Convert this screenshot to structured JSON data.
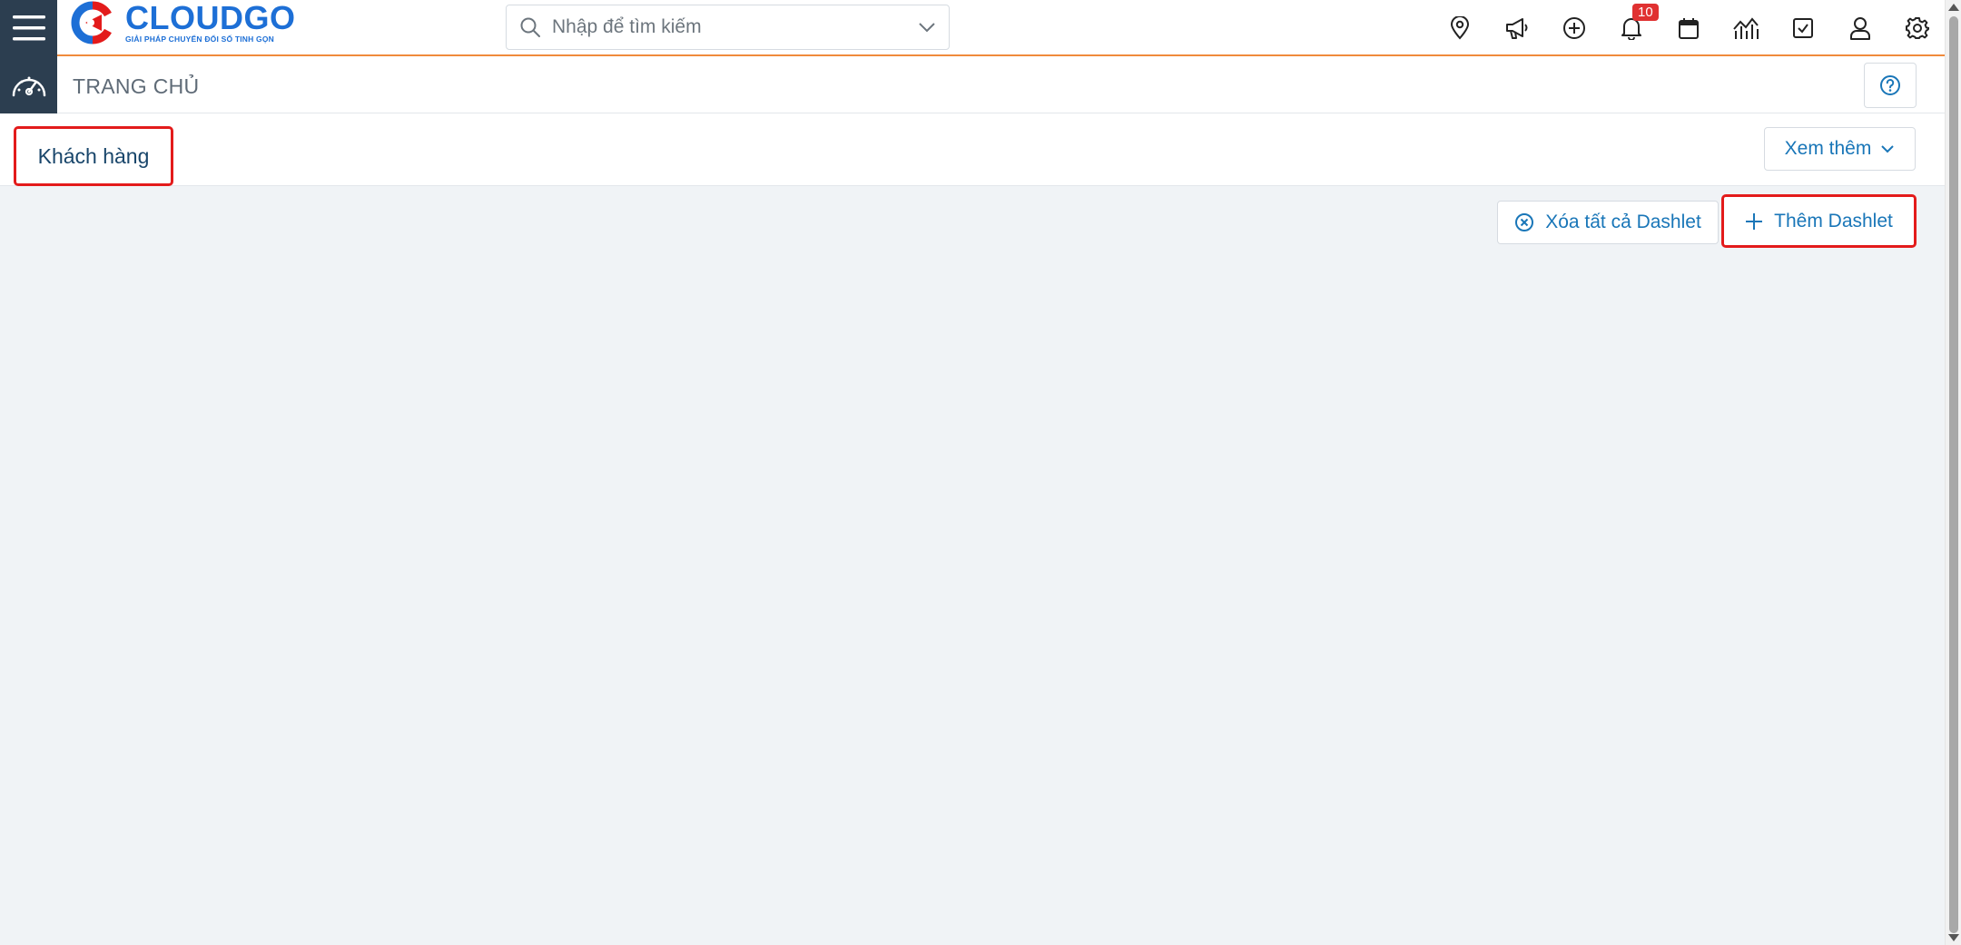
{
  "brand": {
    "name": "CLOUDGO",
    "tagline": "GIẢI PHÁP CHUYỂN ĐỔI SỐ TINH GỌN",
    "color": "#1d6fd6",
    "accent": "#e31b1b"
  },
  "search": {
    "placeholder": "Nhập để tìm kiếm",
    "value": ""
  },
  "toolbar": {
    "icons": [
      "location-pin-icon",
      "megaphone-icon",
      "plus-circle-icon",
      "bell-icon",
      "calendar-icon",
      "chart-icon",
      "checkbox-icon",
      "user-icon",
      "gear-icon"
    ],
    "notification_count": "10"
  },
  "page": {
    "title": "TRANG CHỦ"
  },
  "tabs": {
    "active_label": "Khách hàng",
    "more_label": "Xem thêm"
  },
  "actions": {
    "clear_label": "Xóa tất cả Dashlet",
    "add_label": "Thêm Dashlet"
  },
  "colors": {
    "sidebar": "#2c3e50",
    "link": "#1976b8",
    "topbar_border": "#f08a3c",
    "badge": "#e03131",
    "background": "#f0f3f6"
  }
}
